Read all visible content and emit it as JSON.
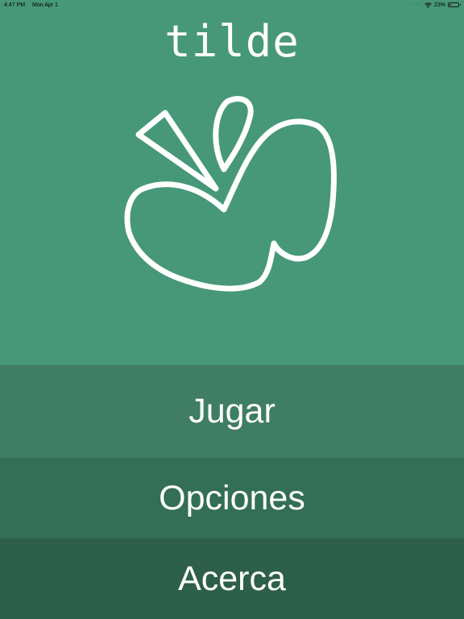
{
  "status_bar": {
    "time": "4:47 PM",
    "date": "Mon Apr 1",
    "battery_percent_text": "23%",
    "battery_level": 0.23
  },
  "app": {
    "title": "tilde",
    "logo_icon": "apple-outline-icon"
  },
  "menu": {
    "play_label": "Jugar",
    "options_label": "Opciones",
    "about_label": "Acerca"
  },
  "colors": {
    "background": "#469878",
    "play_button": "#3f7d64",
    "options_button": "#336f56",
    "about_button": "#2e5f4a",
    "foreground": "#ffffff"
  }
}
